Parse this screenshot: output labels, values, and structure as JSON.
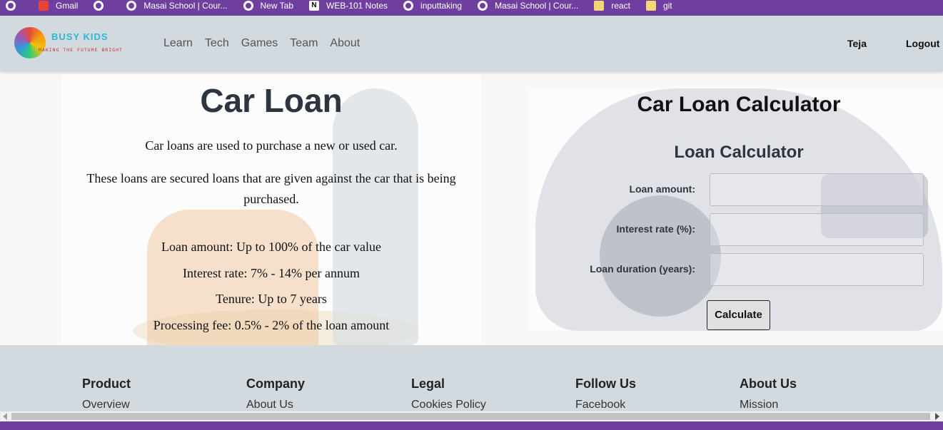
{
  "bookmarks": [
    {
      "label": "",
      "icon": "globe-icon"
    },
    {
      "label": "Gmail",
      "icon": "gmail-icon"
    },
    {
      "label": "",
      "icon": "globe-icon"
    },
    {
      "label": "Masai School | Cour...",
      "icon": "globe-icon"
    },
    {
      "label": "New Tab",
      "icon": "globe-icon"
    },
    {
      "label": "WEB-101 Notes",
      "icon": "notion-icon"
    },
    {
      "label": "inputtaking",
      "icon": "globe-icon"
    },
    {
      "label": "Masai School | Cour...",
      "icon": "globe-icon"
    },
    {
      "label": "react",
      "icon": "folder-icon"
    },
    {
      "label": "git",
      "icon": "folder-icon"
    }
  ],
  "header": {
    "brand": "BUSY KIDS",
    "tagline": "MAKING THE FUTURE BRIGHT",
    "nav": [
      "Learn",
      "Tech",
      "Games",
      "Team",
      "About"
    ],
    "user": "Teja",
    "logout": "Logout"
  },
  "info": {
    "title": "Car Loan",
    "intro": "Car loans are used to purchase a new or used car.",
    "secured": "These loans are secured loans that are given against the car that is being purchased.",
    "facts": [
      "Loan amount: Up to 100% of the car value",
      "Interest rate: 7% - 14% per annum",
      "Tenure: Up to 7 years",
      "Processing fee: 0.5% - 2% of the loan amount"
    ]
  },
  "calculator": {
    "title": "Car Loan Calculator",
    "subtitle": "Loan Calculator",
    "fields": [
      {
        "label": "Loan amount:",
        "value": ""
      },
      {
        "label": "Interest rate (%):",
        "value": ""
      },
      {
        "label": "Loan duration (years):",
        "value": ""
      }
    ],
    "button": "Calculate"
  },
  "footer": [
    {
      "heading": "Product",
      "link": "Overview"
    },
    {
      "heading": "Company",
      "link": "About Us"
    },
    {
      "heading": "Legal",
      "link": "Cookies Policy"
    },
    {
      "heading": "Follow Us",
      "link": "Facebook"
    },
    {
      "heading": "About Us",
      "link": "Mission"
    }
  ],
  "colors": {
    "browser_bar": "#6f3fa0",
    "header_bg": "#d2d9df",
    "brand": "#2cb7d8"
  }
}
